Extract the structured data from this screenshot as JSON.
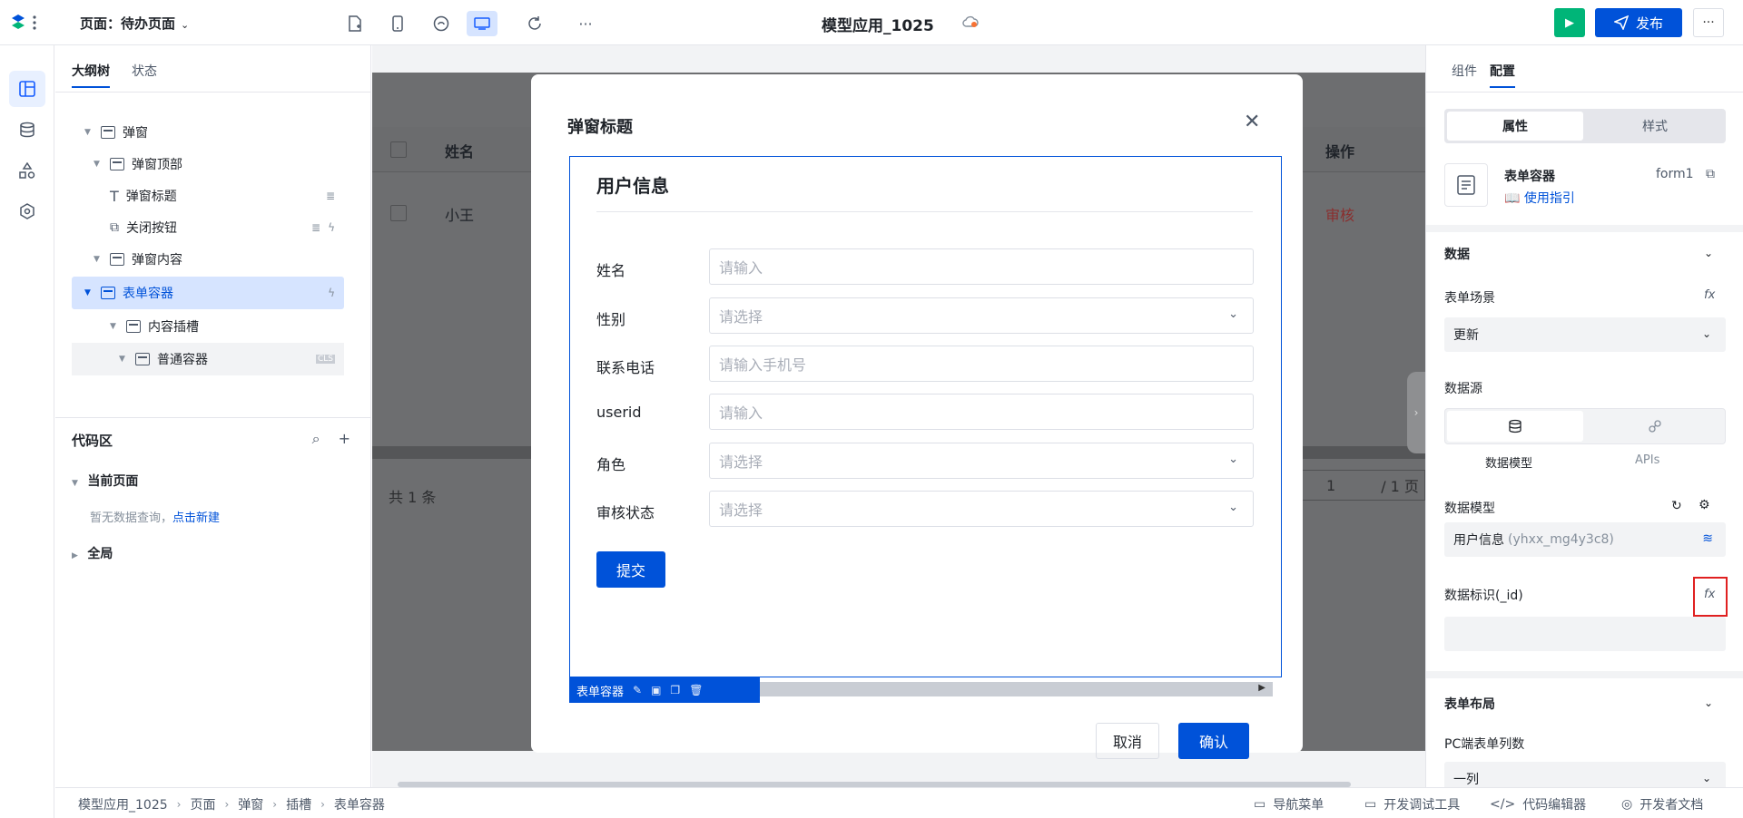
{
  "topbar": {
    "page_select": "页面：待办页面",
    "app_title": "模型应用_1025",
    "publish_label": "发布",
    "more": "···",
    "toolbar_more": "···"
  },
  "outline": {
    "tabs": [
      "大纲树",
      "状态"
    ],
    "tree": [
      {
        "label": "弹窗"
      },
      {
        "label": "弹窗顶部"
      },
      {
        "label": "弹窗标题"
      },
      {
        "label": "关闭按钮"
      },
      {
        "label": "弹窗内容"
      },
      {
        "label": "表单容器"
      },
      {
        "label": "内容插槽"
      },
      {
        "label": "普通容器"
      }
    ],
    "code_title": "代码区",
    "current_page": "当前页面",
    "empty_hint": "暂无数据查询，",
    "empty_link": "点击新建",
    "global": "全局"
  },
  "canvas": {
    "bg_table": {
      "headers": [
        "姓名",
        "操作"
      ],
      "row": {
        "name": "小王",
        "action": "审核"
      },
      "footer_total": "共 1 条",
      "pager_page": "1",
      "pager_total": "/ 1 页"
    }
  },
  "dialog": {
    "title": "弹窗标题",
    "form_heading": "用户信息",
    "fields": [
      {
        "label": "姓名",
        "placeholder": "请输入",
        "type": "input"
      },
      {
        "label": "性别",
        "placeholder": "请选择",
        "type": "select"
      },
      {
        "label": "联系电话",
        "placeholder": "请输入手机号",
        "type": "input"
      },
      {
        "label": "userid",
        "placeholder": "请输入",
        "type": "input"
      },
      {
        "label": "角色",
        "placeholder": "请选择",
        "type": "select"
      },
      {
        "label": "审核状态",
        "placeholder": "请选择",
        "type": "select"
      }
    ],
    "submit_label": "提交",
    "selected_component": "表单容器",
    "cancel_label": "取消",
    "ok_label": "确认"
  },
  "rpanel": {
    "tabs": [
      "组件",
      "配置"
    ],
    "segments": [
      "属性",
      "样式"
    ],
    "component_name": "表单容器",
    "component_id": "form1",
    "guide_link": "使用指引",
    "section_data": "数据",
    "form_scene_label": "表单场景",
    "form_scene_value": "更新",
    "datasource_label": "数据源",
    "datasource_options": [
      "数据模型",
      "APIs"
    ],
    "data_model_label": "数据模型",
    "data_model_value": "用户信息",
    "data_model_id": "(yhxx_mg4y3c8)",
    "data_id_label": "数据标识(_id)",
    "fx": "fx",
    "section_layout": "表单布局",
    "pc_cols_label": "PC端表单列数",
    "pc_cols_value": "一列"
  },
  "statusbar": {
    "breadcrumbs": [
      "模型应用_1025",
      "页面",
      "弹窗",
      "插槽",
      "表单容器"
    ],
    "nav_menu": "导航菜单",
    "dev_tools": "开发调试工具",
    "code_editor": "代码编辑器",
    "dev_docs": "开发者文档"
  },
  "colors": {
    "primary": "#0052d9",
    "success": "#00b578",
    "danger": "#e02020"
  }
}
